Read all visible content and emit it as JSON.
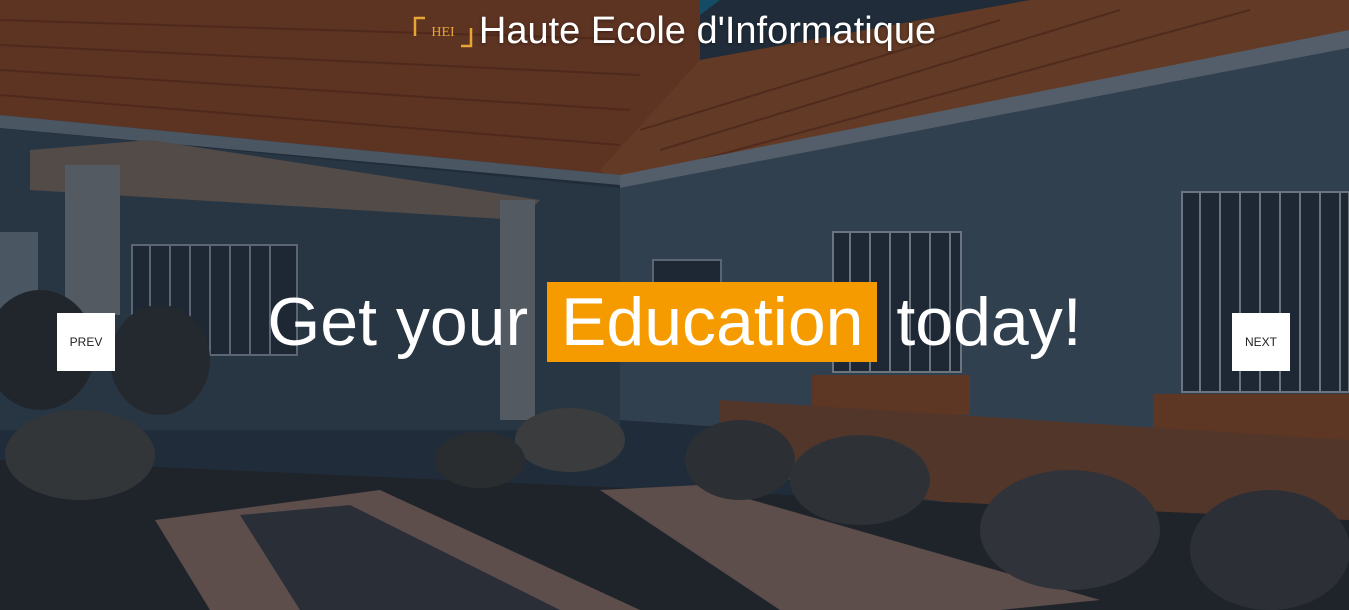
{
  "brand": {
    "logo_text": "HEI",
    "name": "Haute Ecole d'Informatique"
  },
  "headline": {
    "before": "Get your ",
    "highlight": "Education",
    "after": " today!"
  },
  "carousel": {
    "prev_label": "PREV",
    "next_label": "NEXT"
  },
  "colors": {
    "accent": "#f59b00",
    "roof": "#8a4525",
    "wall": "#3a4a58"
  }
}
